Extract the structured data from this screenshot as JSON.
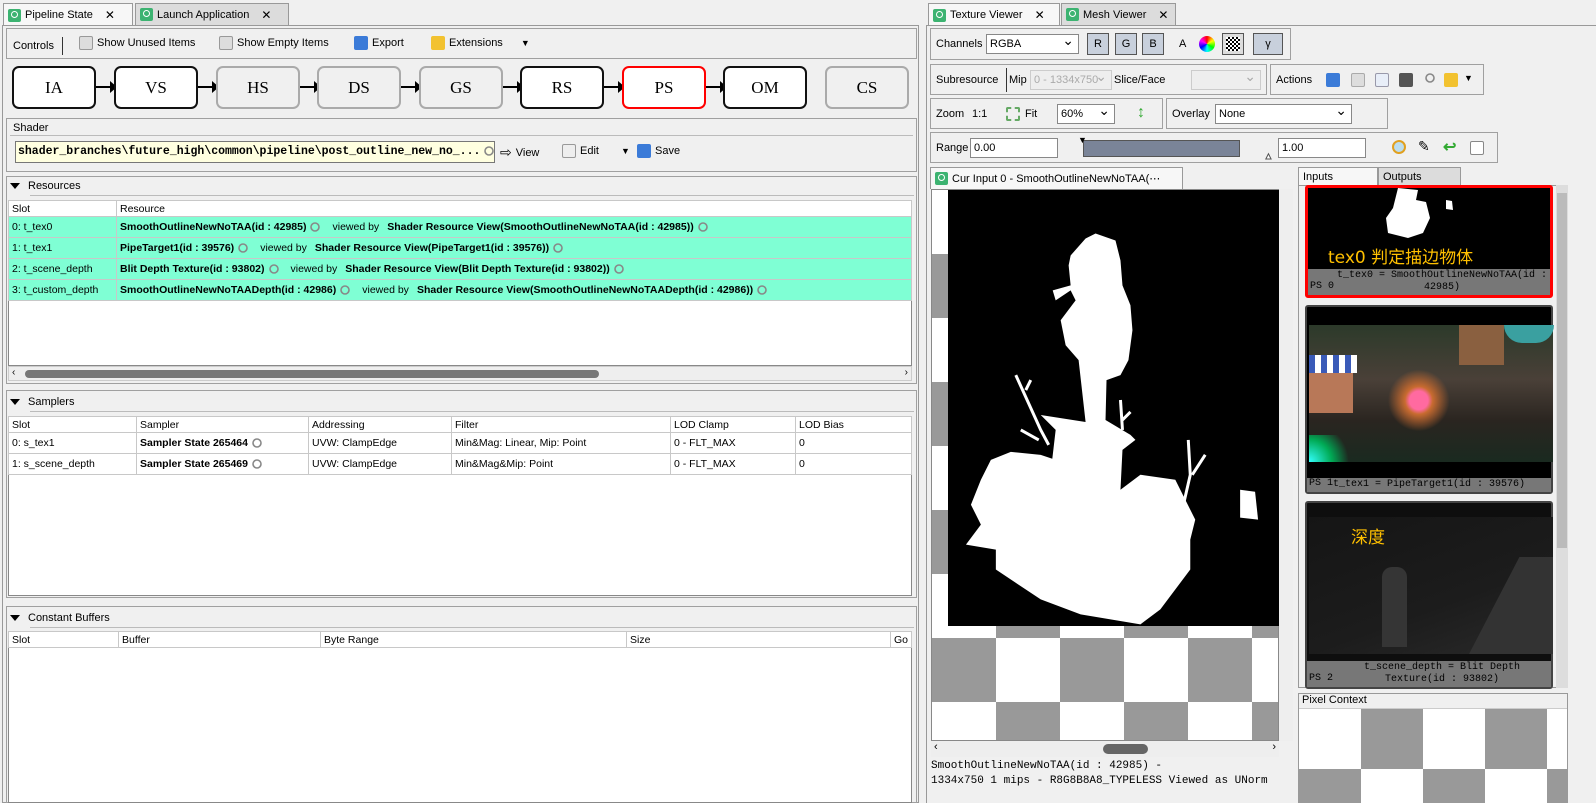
{
  "left_tabs": [
    {
      "label": "Pipeline State"
    },
    {
      "label": "Launch Application"
    }
  ],
  "toolbar": {
    "controls": "Controls",
    "show_unused": "Show Unused Items",
    "show_empty": "Show Empty Items",
    "export": "Export",
    "extensions": "Extensions"
  },
  "stages": [
    "IA",
    "VS",
    "HS",
    "DS",
    "GS",
    "RS",
    "PS",
    "OM",
    "CS"
  ],
  "shader": {
    "label": "Shader",
    "path": "shader_branches\\future_high\\common\\pipeline\\post_outline_new_no_...",
    "view": "View",
    "edit": "Edit",
    "save": "Save"
  },
  "resources": {
    "title": "Resources",
    "columns": [
      "Slot",
      "Resource"
    ],
    "viewed_by": "viewed  by",
    "rows": [
      {
        "slot": "0: t_tex0",
        "res": "SmoothOutlineNewNoTAA(id : 42985)",
        "view": "Shader Resource View(SmoothOutlineNewNoTAA(id : 42985))"
      },
      {
        "slot": "1: t_tex1",
        "res": "PipeTarget1(id : 39576)",
        "view": "Shader Resource View(PipeTarget1(id : 39576))"
      },
      {
        "slot": "2: t_scene_depth",
        "res": "Blit Depth Texture(id : 93802)",
        "view": "Shader Resource View(Blit Depth Texture(id : 93802))"
      },
      {
        "slot": "3: t_custom_depth",
        "res": "SmoothOutlineNewNoTAADepth(id : 42986)",
        "view": "Shader Resource View(SmoothOutlineNewNoTAADepth(id : 42986))"
      }
    ]
  },
  "samplers": {
    "title": "Samplers",
    "columns": [
      "Slot",
      "Sampler",
      "Addressing",
      "Filter",
      "LOD Clamp",
      "LOD Bias"
    ],
    "rows": [
      [
        "0: s_tex1",
        "Sampler State 265464",
        "UVW: ClampEdge",
        "Min&Mag: Linear, Mip: Point",
        "0 - FLT_MAX",
        "0"
      ],
      [
        "1: s_scene_depth",
        "Sampler State 265469",
        "UVW: ClampEdge",
        "Min&Mag&Mip: Point",
        "0 - FLT_MAX",
        "0"
      ]
    ]
  },
  "cbuffers": {
    "title": "Constant Buffers",
    "columns": [
      "Slot",
      "Buffer",
      "Byte Range",
      "Size",
      "Go"
    ]
  },
  "right_tabs": [
    {
      "label": "Texture Viewer"
    },
    {
      "label": "Mesh Viewer"
    }
  ],
  "texview": {
    "channels_label": "Channels",
    "channels": "RGBA",
    "r": "R",
    "g": "G",
    "b": "B",
    "a": "A",
    "gamma": "γ",
    "subresource": "Subresource",
    "mip_label": "Mip",
    "mip": "0 - 1334x750",
    "slice_label": "Slice/Face",
    "actions": "Actions",
    "zoom_label": "Zoom",
    "zoom_11": "1:1",
    "fit": "Fit",
    "zoom": "60%",
    "overlay_label": "Overlay",
    "overlay": "None",
    "range_label": "Range",
    "range_min": "0.00",
    "range_max": "1.00",
    "cur_input_tab": "Cur Input 0 - SmoothOutlineNewNoTAA(⋯",
    "status_line1": "SmoothOutlineNewNoTAA(id : 42985) -",
    "status_line2": "1334x750 1 mips - R8G8B8A8_TYPELESS Viewed as UNorm"
  },
  "thumbs": {
    "inputs_tab": "Inputs",
    "outputs_tab": "Outputs",
    "items": [
      {
        "ps": "PS 0",
        "caption": "t_tex0 = SmoothOutlineNewNoTAA(id : 42985)",
        "overlay": "tex0 判定描边物体"
      },
      {
        "ps": "PS 1",
        "caption": "t_tex1 = PipeTarget1(id : 39576)"
      },
      {
        "ps": "PS 2",
        "caption": "t_scene_depth = Blit Depth Texture(id : 93802)",
        "overlay": "深度"
      }
    ]
  },
  "pixel_context": "Pixel Context",
  "colors": {
    "resource_row": "#7fffd4",
    "selected_stage": "#ff0000",
    "overlay_text": "#ffc000"
  }
}
